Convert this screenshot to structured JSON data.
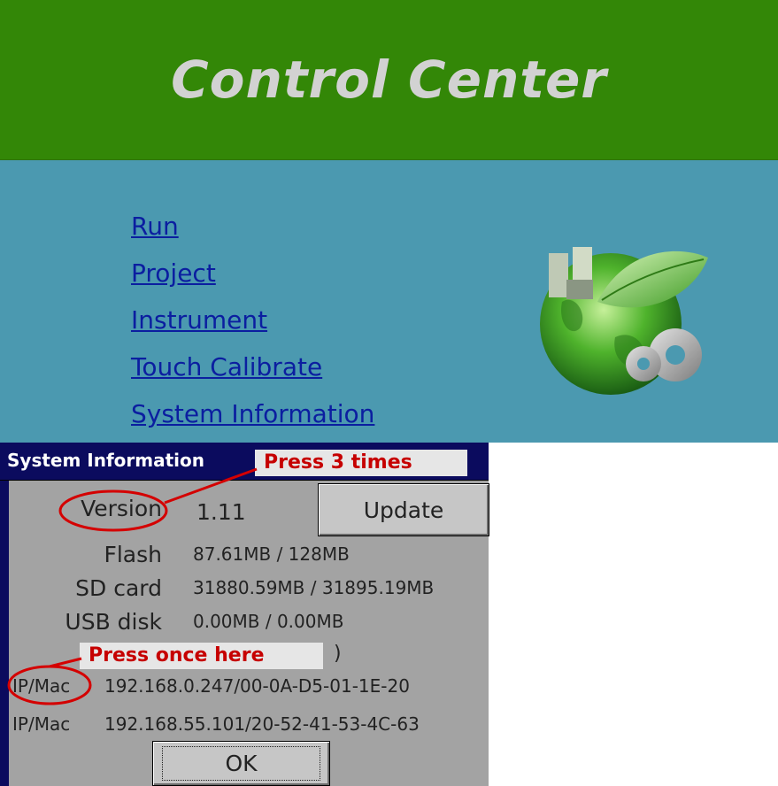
{
  "control_center": {
    "title": "Control Center",
    "menu": [
      {
        "label": "Run"
      },
      {
        "label": "Project"
      },
      {
        "label": "Instrument"
      },
      {
        "label": "Touch Calibrate"
      },
      {
        "label": "System Information"
      }
    ],
    "logo_icon": "earth-leaf-gears-icon"
  },
  "system_information": {
    "title": "System Information",
    "annotations": {
      "press_three": "Press 3 times",
      "press_once": "Press once here"
    },
    "version_label": "Version",
    "version_value": "1.11",
    "update_button": "Update",
    "flash_label": "Flash",
    "flash_value": "87.61MB / 128MB",
    "sd_label": "SD card",
    "sd_value": "31880.59MB / 31895.19MB",
    "usb_label": "USB disk",
    "usb_value": "0.00MB / 0.00MB",
    "paren": ")",
    "ip1_label": "IP/Mac",
    "ip1_value": "192.168.0.247/00-0A-D5-01-1E-20",
    "ip2_label": "IP/Mac",
    "ip2_value": "192.168.55.101/20-52-41-53-4C-63",
    "ok_button": "OK"
  },
  "colors": {
    "header_green": "#338707",
    "body_teal": "#4b99b0",
    "link_blue": "#0b1ea0",
    "dialog_gray": "#a3a3a3",
    "titlebar_navy": "#0b0b5e",
    "annotation_red": "#c60000"
  }
}
